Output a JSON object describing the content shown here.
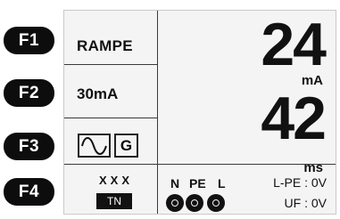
{
  "function_keys": {
    "f1": "F1",
    "f2": "F2",
    "f3": "F3",
    "f4": "F4"
  },
  "left_panel": {
    "mode": "RAMPE",
    "current": "30mA",
    "waveform_icon": "sine-wave-icon",
    "type_label": "G",
    "network_code": "XXX",
    "network": "TN"
  },
  "main_panel": {
    "value1": "24",
    "unit1": "mA",
    "value2": "42",
    "unit2": "ms"
  },
  "terminals": {
    "n": "N",
    "pe": "PE",
    "l": "L"
  },
  "status": {
    "lpe": "L-PE : 0V",
    "uf": "UF : 0V"
  },
  "colors": {
    "lcd_background": "#f4f4f4",
    "key_background": "#0d0d0d",
    "text": "#111111"
  }
}
